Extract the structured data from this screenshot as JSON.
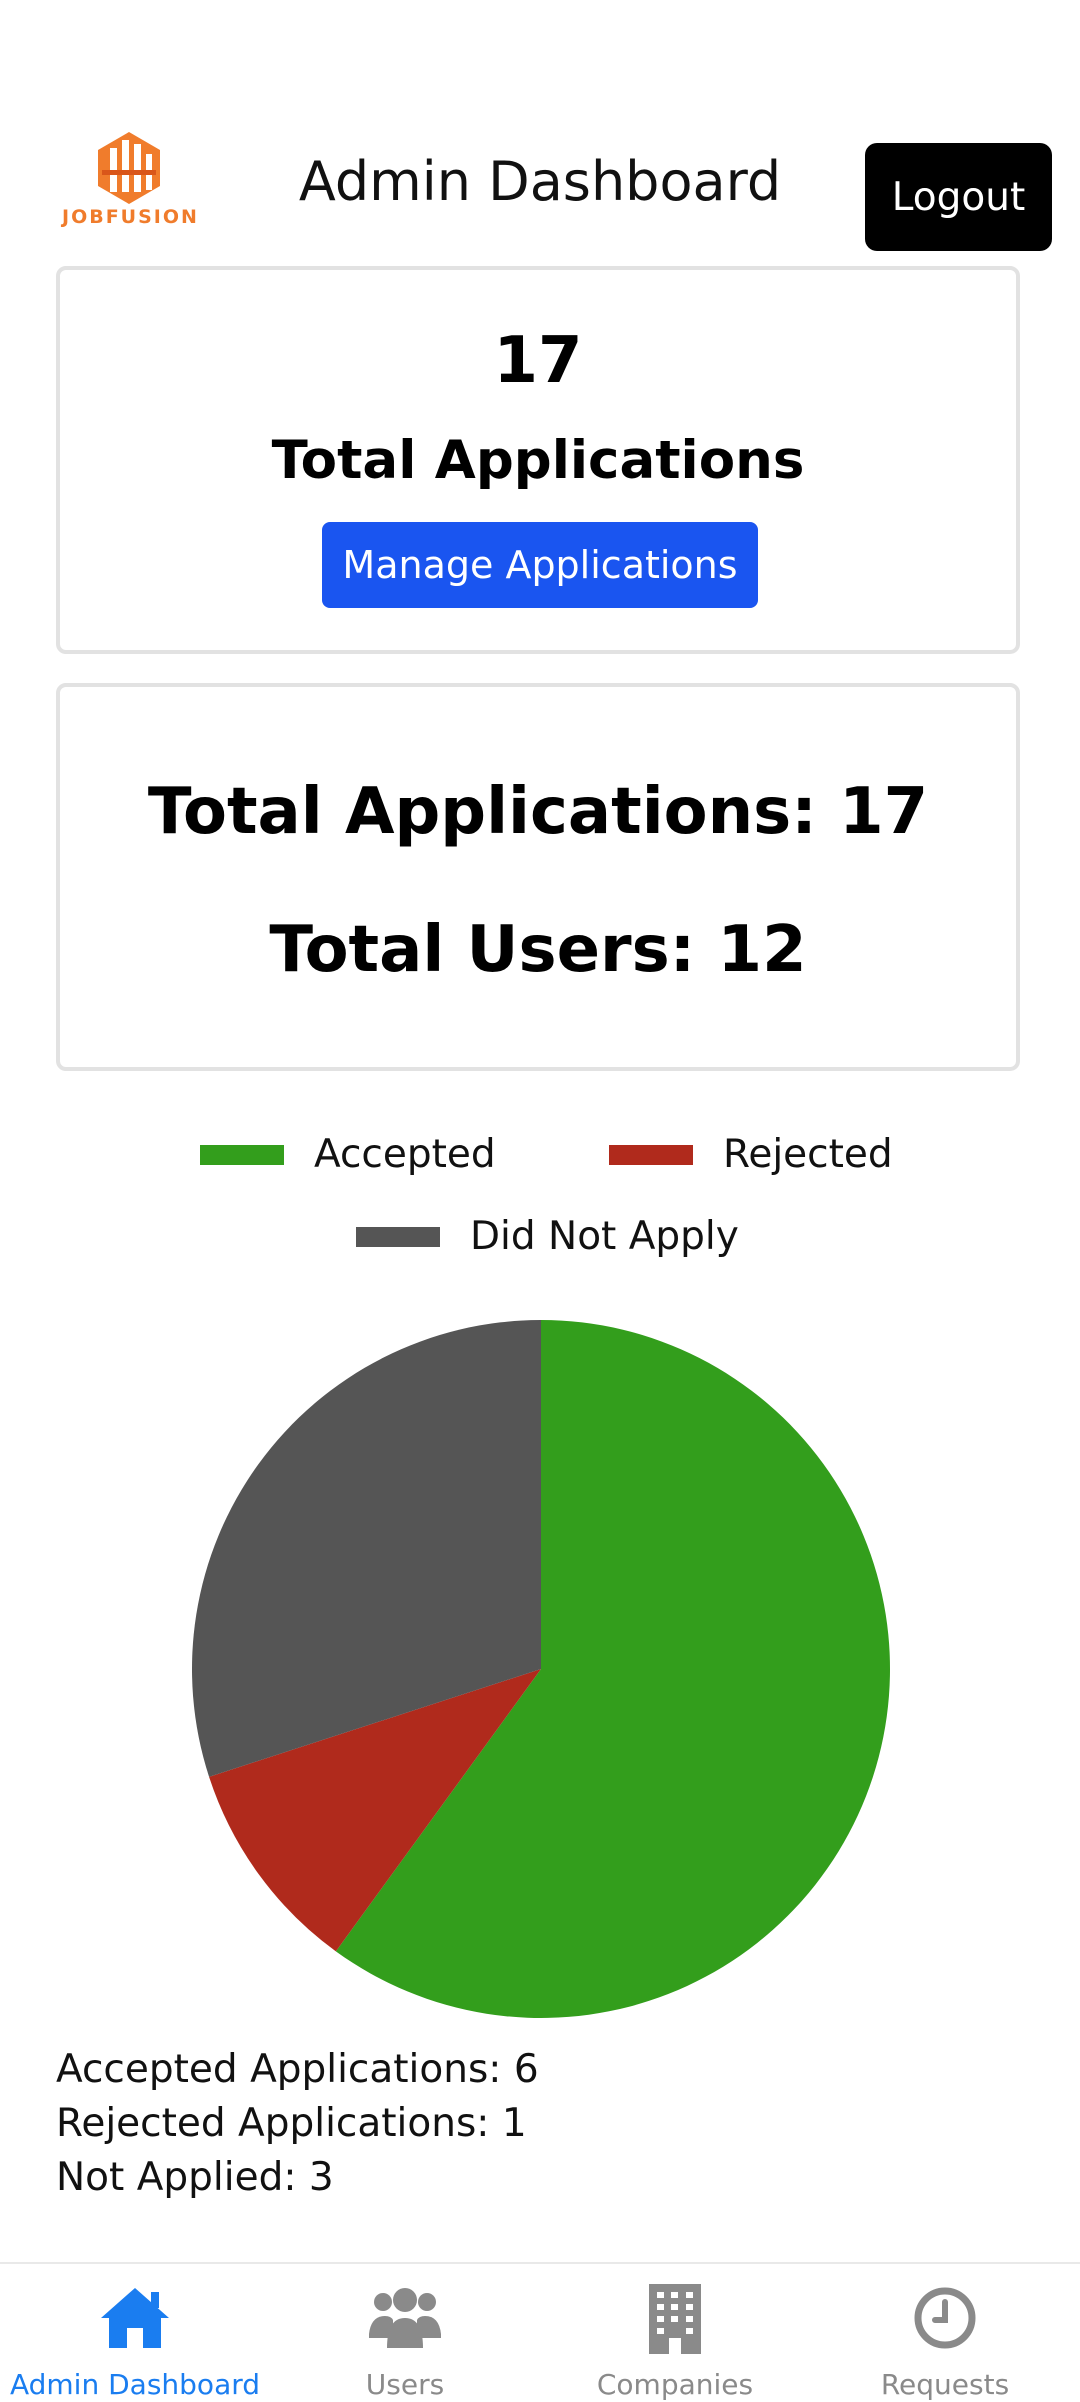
{
  "header": {
    "logo_text": "JOBFUSION",
    "title": "Admin Dashboard",
    "logout_label": "Logout"
  },
  "applications_card": {
    "count": "17",
    "title": "Total Applications",
    "manage_label": "Manage Applications"
  },
  "stats_card": {
    "total_applications": "Total Applications: 17",
    "total_users": "Total Users: 12"
  },
  "chart_data": {
    "type": "pie",
    "series": [
      {
        "name": "Accepted",
        "value": 6,
        "color": "#339e1c"
      },
      {
        "name": "Rejected",
        "value": 1,
        "color": "#b02a1c"
      },
      {
        "name": "Did Not Apply",
        "value": 3,
        "color": "#555555"
      }
    ],
    "legend_position": "top"
  },
  "summary": {
    "accepted": "Accepted Applications: 6",
    "rejected": "Rejected Applications: 1",
    "not_applied": "Not Applied: 3"
  },
  "bottom_nav": {
    "items": [
      {
        "label": "Admin Dashboard",
        "icon": "home-icon",
        "active": true
      },
      {
        "label": "Users",
        "icon": "users-icon",
        "active": false
      },
      {
        "label": "Companies",
        "icon": "building-icon",
        "active": false
      },
      {
        "label": "Requests",
        "icon": "clock-icon",
        "active": false
      }
    ]
  },
  "colors": {
    "accent": "#1a55f0",
    "nav_active": "#1a7df0",
    "logo": "#f07c2c"
  }
}
